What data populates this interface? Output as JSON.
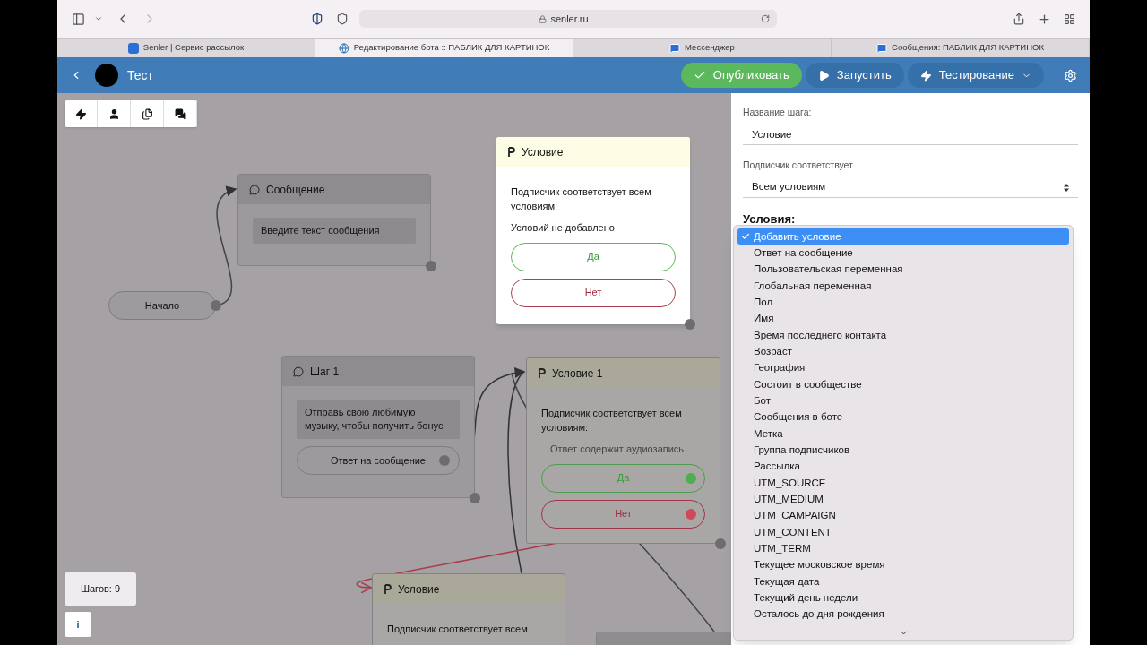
{
  "browser": {
    "url": "senler.ru",
    "tabs": [
      {
        "title": "Senler | Сервис рассылок",
        "selected": false
      },
      {
        "title": "Редактирование бота :: ПАБЛИК ДЛЯ КАРТИНОК",
        "selected": true
      },
      {
        "title": "Мессенджер",
        "selected": false
      },
      {
        "title": "Сообщения: ПАБЛИК ДЛЯ КАРТИНОК",
        "selected": false
      }
    ]
  },
  "header": {
    "title": "Тест",
    "buttons": [
      {
        "label": "Опубликовать",
        "kind": "publish"
      },
      {
        "label": "Запустить",
        "kind": "run"
      },
      {
        "label": "Тестирование",
        "kind": "test"
      }
    ]
  },
  "canvas": {
    "nodes": [
      {
        "kind": "message",
        "title": "Сообщение",
        "message": "Введите текст сообщения",
        "highlighted": false
      },
      {
        "kind": "start",
        "label": "Начало"
      },
      {
        "kind": "condition",
        "title": "Условие",
        "description": "Подписчик соответствует всем условиям:",
        "note": "Условий не добавлено",
        "yes": "Да",
        "no": "Нет",
        "highlighted": true
      },
      {
        "kind": "message",
        "title": "Шаг 1",
        "message": "Отправь свою любимую музыку, чтобы получить бонус",
        "reply": "Ответ на сообщение",
        "highlighted": false
      },
      {
        "kind": "condition",
        "title": "Условие 1",
        "description": "Подписчик соответствует всем условиям:",
        "conditions": [
          "Ответ содержит аудиозапись"
        ],
        "yes": "Да",
        "no": "Нет",
        "highlighted": false
      },
      {
        "kind": "condition",
        "title": "Условие",
        "description": "Подписчик соответствует всем",
        "highlighted": false
      },
      {
        "kind": "message",
        "highlighted": false
      }
    ],
    "steps": "Шагов: 9",
    "info": "i"
  },
  "panel": {
    "step_name_label": "Название шага:",
    "step_name": "Условие",
    "match_label": "Подписчик соответствует",
    "match": "Всем условиям",
    "conditions_heading": "Условия:",
    "menu": [
      {
        "label": "Добавить условие",
        "selected": true
      },
      {
        "label": "Ответ на сообщение",
        "selected": false
      },
      {
        "label": "Пользовательская переменная",
        "selected": false
      },
      {
        "label": "Глобальная переменная",
        "selected": false
      },
      {
        "label": "Пол",
        "selected": false
      },
      {
        "label": "Имя",
        "selected": false
      },
      {
        "label": "Время последнего контакта",
        "selected": false
      },
      {
        "label": "Возраст",
        "selected": false
      },
      {
        "label": "География",
        "selected": false
      },
      {
        "label": "Состоит в сообществе",
        "selected": false
      },
      {
        "label": "Бот",
        "selected": false
      },
      {
        "label": "Сообщения в боте",
        "selected": false
      },
      {
        "label": "Метка",
        "selected": false
      },
      {
        "label": "Группа подписчиков",
        "selected": false
      },
      {
        "label": "Рассылка",
        "selected": false
      },
      {
        "label": "UTM_SOURCE",
        "selected": false
      },
      {
        "label": "UTM_MEDIUM",
        "selected": false
      },
      {
        "label": "UTM_CAMPAIGN",
        "selected": false
      },
      {
        "label": "UTM_CONTENT",
        "selected": false
      },
      {
        "label": "UTM_TERM",
        "selected": false
      },
      {
        "label": "Текущее московское время",
        "selected": false
      },
      {
        "label": "Текущая дата",
        "selected": false
      },
      {
        "label": "Текущий день недели",
        "selected": false
      },
      {
        "label": "Осталось до дня рождения",
        "selected": false
      }
    ]
  }
}
